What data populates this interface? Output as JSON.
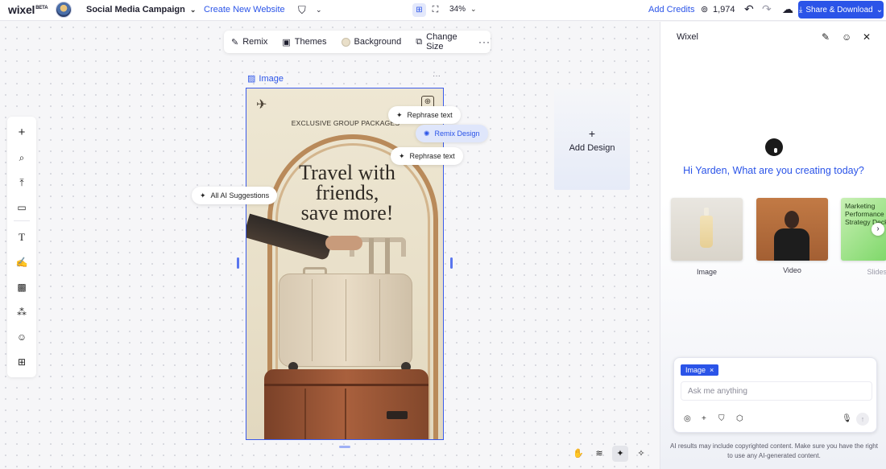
{
  "topbar": {
    "logo": "wixel",
    "logo_badge": "BETA",
    "project_name": "Social Media Campaign",
    "create_site": "Create New Website",
    "zoom": "34%",
    "add_credits": "Add Credits",
    "credits_count": "1,974",
    "share_label": "Share & Download"
  },
  "toolbar": {
    "remix": "Remix",
    "themes": "Themes",
    "background": "Background",
    "change_size": "Change Size",
    "more": "···"
  },
  "selection": {
    "label": "Image",
    "dots": "···"
  },
  "design": {
    "tagline": "EXCLUSIVE GROUP PACKAGES",
    "headline_1": "Travel with",
    "headline_2": "friends,",
    "headline_3": "save more!"
  },
  "ai_pills": {
    "rephrase_1": "Rephrase text",
    "remix_design": "Remix Design",
    "rephrase_2": "Rephrase text",
    "all_suggestions": "All AI Suggestions"
  },
  "add_design": {
    "plus": "+",
    "label": "Add Design"
  },
  "panel": {
    "title": "Wixel",
    "greeting": "Hi Yarden, What are you creating today?",
    "cards": [
      {
        "label": "Image"
      },
      {
        "label": "Video"
      },
      {
        "label": "Slides",
        "preview_text": "Marketing Performance & Strategy Deck"
      }
    ],
    "chip": "Image",
    "chip_close": "×",
    "input_placeholder": "Ask me anything",
    "disclaimer": "AI results may include copyrighted content. Make sure you have the right to use any AI-generated content."
  },
  "colors": {
    "accent": "#2b54e8",
    "selection": "#3b5bea"
  }
}
